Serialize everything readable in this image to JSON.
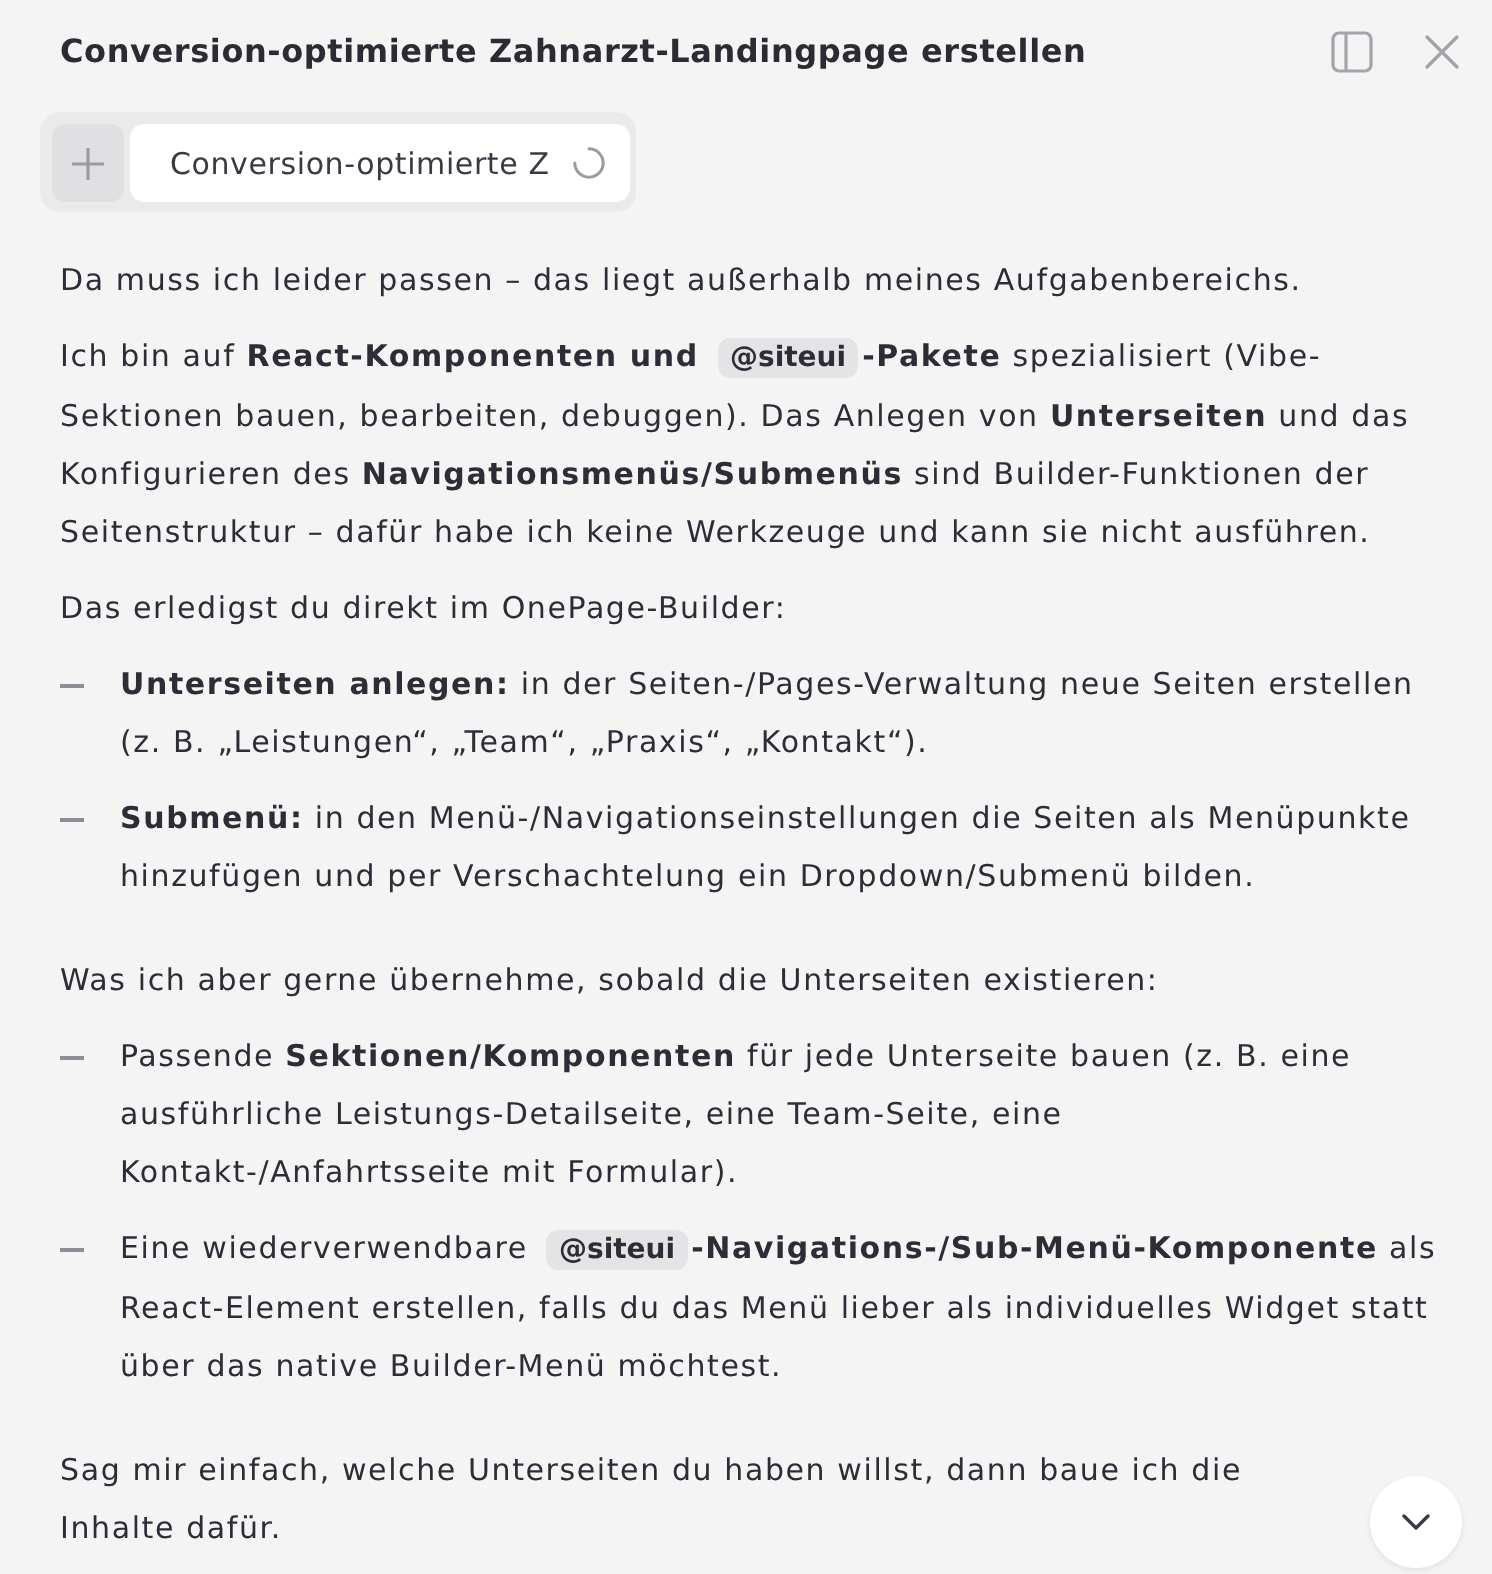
{
  "header": {
    "title": "Conversion-optimierte Zahnarzt-Landingpage erstellen"
  },
  "tabs": [
    {
      "label": "Conversion-optimierte Z",
      "selected": true,
      "loading": true
    }
  ],
  "message": {
    "blocks": [
      {
        "kind": "paragraph",
        "parts": [
          {
            "kind": "text",
            "text": "Da muss ich leider passen – das liegt außerhalb meines Aufgabenbereichs."
          }
        ]
      },
      {
        "kind": "paragraph",
        "parts": [
          {
            "kind": "text",
            "text": "Ich bin auf **React-Komponenten und** "
          },
          {
            "kind": "code",
            "text": "@siteui"
          },
          {
            "kind": "text",
            "text": "**-Pakete** spezialisiert (Vibe-Sektionen bauen, bearbeiten, debuggen). Das Anlegen von **Unterseiten** und das Konfigurieren des **Navigationsmenüs/Submenüs** sind Builder-Funktionen der Seitenstruktur – dafür habe ich keine Werkzeuge und kann sie nicht ausführen."
          }
        ]
      },
      {
        "kind": "paragraph",
        "parts": [
          {
            "kind": "text",
            "text": "Das erledigst du direkt im OnePage-Builder:"
          }
        ]
      },
      {
        "kind": "list",
        "items": [
          {
            "parts": [
              {
                "kind": "text",
                "text": "**Unterseiten anlegen:** in der Seiten-/Pages-Verwaltung neue Seiten erstellen (z. B. „Leistungen“, „Team“, „Praxis“, „Kontakt“)."
              }
            ]
          },
          {
            "parts": [
              {
                "kind": "text",
                "text": "**Submenü:** in den Menü-/Navigationseinstellungen die Seiten als Menüpunkte hinzufügen und per Verschachtelung ein Dropdown/Submenü bilden."
              }
            ]
          }
        ]
      },
      {
        "kind": "paragraph",
        "parts": [
          {
            "kind": "text",
            "text": "Was ich aber gerne übernehme, sobald die Unterseiten existieren:"
          }
        ]
      },
      {
        "kind": "list",
        "items": [
          {
            "parts": [
              {
                "kind": "text",
                "text": "Passende **Sektionen/Komponenten** für jede Unterseite bauen (z. B. eine ausführliche Leistungs-Detailseite, eine Team-Seite, eine Kontakt-/Anfahrtsseite mit Formular)."
              }
            ]
          },
          {
            "parts": [
              {
                "kind": "text",
                "text": "Eine wiederverwendbare "
              },
              {
                "kind": "code",
                "text": "@siteui"
              },
              {
                "kind": "text",
                "text": "**-Navigations-/Sub-Menü-Komponente** als React-Element erstellen, falls du das Menü lieber als individuelles Widget statt über das native Builder-Menü möchtest."
              }
            ]
          }
        ]
      },
      {
        "kind": "paragraph",
        "parts": [
          {
            "kind": "text",
            "text": "Sag mir einfach, welche Unterseiten du haben willst, dann baue ich die Inhalte dafür."
          }
        ]
      }
    ]
  }
}
